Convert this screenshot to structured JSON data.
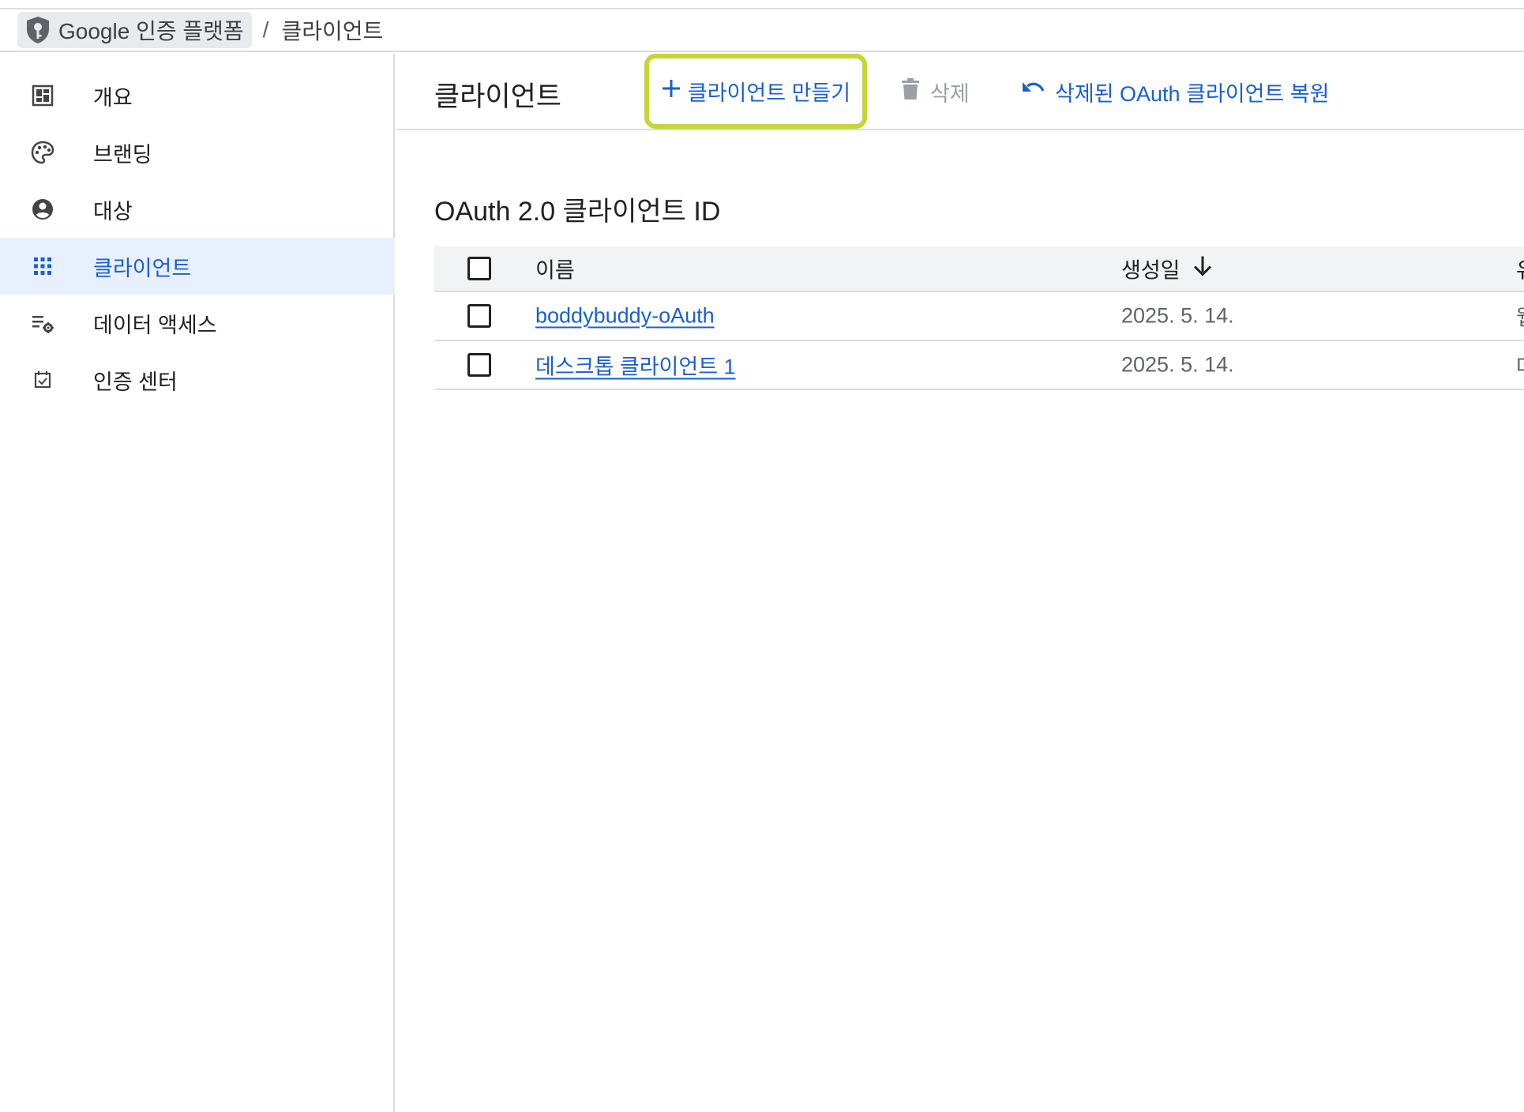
{
  "breadcrumb": {
    "product": "Google 인증 플랫폼",
    "separator": "/",
    "current": "클라이언트"
  },
  "sidebar": {
    "items": [
      {
        "label": "개요",
        "icon": "dashboard-icon"
      },
      {
        "label": "브랜딩",
        "icon": "palette-icon"
      },
      {
        "label": "대상",
        "icon": "account-circle-icon"
      },
      {
        "label": "클라이언트",
        "icon": "apps-grid-icon",
        "active": true
      },
      {
        "label": "데이터 액세스",
        "icon": "list-settings-icon"
      },
      {
        "label": "인증 센터",
        "icon": "checkbox-icon"
      }
    ]
  },
  "toolbar": {
    "title": "클라이언트",
    "create_label": "클라이언트 만들기",
    "delete_label": "삭제",
    "restore_label": "삭제된 OAuth 클라이언트 복원"
  },
  "section": {
    "title": "OAuth 2.0 클라이언트 ID"
  },
  "table": {
    "columns": {
      "name": "이름",
      "created": "생성일",
      "type": "유"
    },
    "rows": [
      {
        "name": "boddybuddy-oAuth",
        "created": "2025. 5. 14.",
        "type": "웹"
      },
      {
        "name": "데스크톱 클라이언트 1",
        "created": "2025. 5. 14.",
        "type": "데"
      }
    ]
  },
  "colors": {
    "accent": "#1a5fd0",
    "highlight": "#c6d43a",
    "active_bg": "#e8f0fe",
    "disabled": "#9aa0a6"
  }
}
